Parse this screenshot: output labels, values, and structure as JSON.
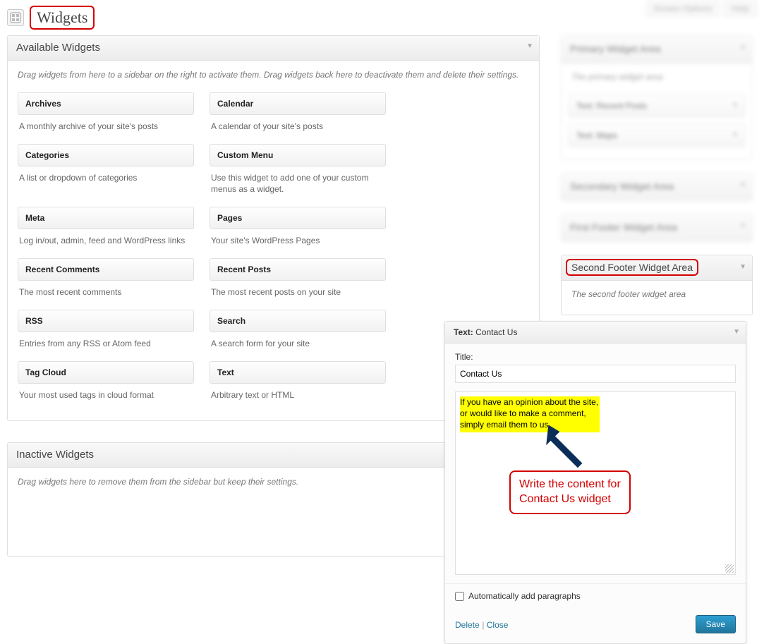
{
  "header": {
    "page_title": "Widgets",
    "screen_options": "Screen Options",
    "help": "Help"
  },
  "available": {
    "title": "Available Widgets",
    "description": "Drag widgets from here to a sidebar on the right to activate them. Drag widgets back here to deactivate them and delete their settings.",
    "items": [
      {
        "title": "Archives",
        "desc": "A monthly archive of your site's posts"
      },
      {
        "title": "Calendar",
        "desc": "A calendar of your site's posts"
      },
      {
        "title": "Categories",
        "desc": "A list or dropdown of categories"
      },
      {
        "title": "Custom Menu",
        "desc": "Use this widget to add one of your custom menus as a widget."
      },
      {
        "title": "Meta",
        "desc": "Log in/out, admin, feed and WordPress links"
      },
      {
        "title": "Pages",
        "desc": "Your site's WordPress Pages"
      },
      {
        "title": "Recent Comments",
        "desc": "The most recent comments"
      },
      {
        "title": "Recent Posts",
        "desc": "The most recent posts on your site"
      },
      {
        "title": "RSS",
        "desc": "Entries from any RSS or Atom feed"
      },
      {
        "title": "Search",
        "desc": "A search form for your site"
      },
      {
        "title": "Tag Cloud",
        "desc": "Your most used tags in cloud format"
      },
      {
        "title": "Text",
        "desc": "Arbitrary text or HTML"
      }
    ]
  },
  "inactive": {
    "title": "Inactive Widgets",
    "description": "Drag widgets here to remove them from the sidebar but keep their settings."
  },
  "sidebars": {
    "primary": {
      "title": "Primary Widget Area",
      "desc": "The primary widget area",
      "widgets": [
        "Text: Recent Posts",
        "Text: Maps"
      ]
    },
    "secondary": {
      "title": "Secondary Widget Area"
    },
    "first_footer": {
      "title": "First Footer Widget Area"
    },
    "second_footer": {
      "title": "Second Footer Widget Area",
      "desc": "The second footer widget area"
    }
  },
  "editor": {
    "head_prefix": "Text:",
    "head_name": " Contact Us",
    "title_label": "Title:",
    "title_value": "Contact Us",
    "content": "If you have an opinion about the site,\nor would like to make a comment,\nsimply email them to us.",
    "autop_label": "Automatically add paragraphs",
    "delete": "Delete",
    "close": "Close",
    "save": "Save"
  },
  "annotation": {
    "text": "Write the content for\nContact Us widget"
  }
}
